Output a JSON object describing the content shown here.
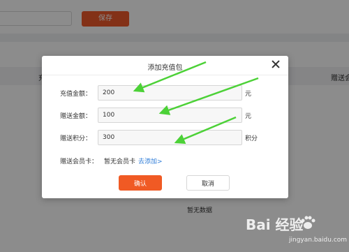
{
  "background": {
    "save_label": "保存",
    "table_col_left": "充",
    "table_col_right": "赠送会员",
    "empty_text": "暂无数据"
  },
  "dialog": {
    "title": "添加充值包",
    "fields": [
      {
        "label": "充值金额：",
        "value": "200",
        "unit": "元"
      },
      {
        "label": "赠送金额：",
        "value": "100",
        "unit": "元"
      },
      {
        "label": "赠送积分：",
        "value": "300",
        "unit": "积分"
      }
    ],
    "member_card": {
      "label": "赠送会员卡：",
      "text": "暂无会员卡",
      "link": "去添加>"
    },
    "confirm_label": "确认",
    "cancel_label": "取消"
  },
  "annotation": {
    "arrow_color": "#4cd137"
  },
  "colors": {
    "primary": "#f05a24",
    "link": "#2e7cd8"
  },
  "watermark": {
    "brand": "Bai  经验",
    "url": "jingyan.baidu.com"
  }
}
